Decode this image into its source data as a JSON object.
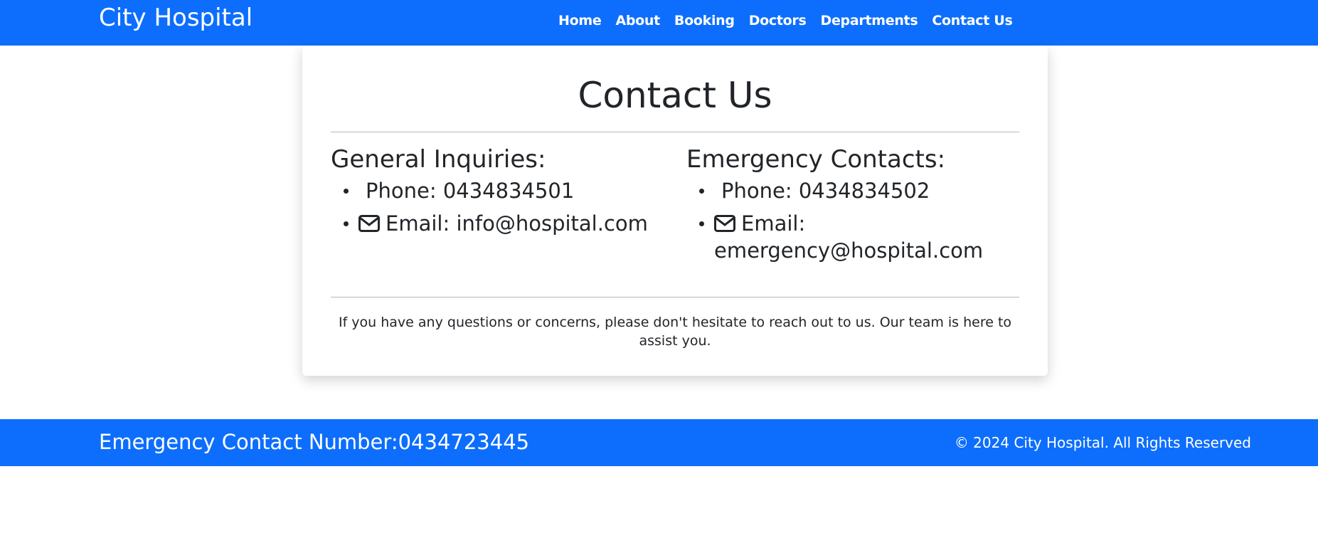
{
  "navbar": {
    "brand": "City Hospital",
    "links": [
      "Home",
      "About",
      "Booking",
      "Doctors",
      "Departments",
      "Contact Us"
    ],
    "background": "#0d6efd"
  },
  "card": {
    "title": "Contact Us",
    "general": {
      "heading": "General Inquiries:",
      "phone": "Phone: 0434834501",
      "email": "Email: info@hospital.com"
    },
    "emergency": {
      "heading": "Emergency Contacts:",
      "phone": "Phone: 0434834502",
      "email_label": "Email:",
      "email_value": "emergency@hospital.com"
    },
    "note": "If you have any questions or concerns, please don't hesitate to reach out to us. Our team is here to assist you."
  },
  "footer": {
    "emergency_number": "Emergency Contact Number:0434723445",
    "copyright": "© 2024 City Hospital. All Rights Reserved"
  },
  "icons": {
    "email": "envelope-icon"
  }
}
